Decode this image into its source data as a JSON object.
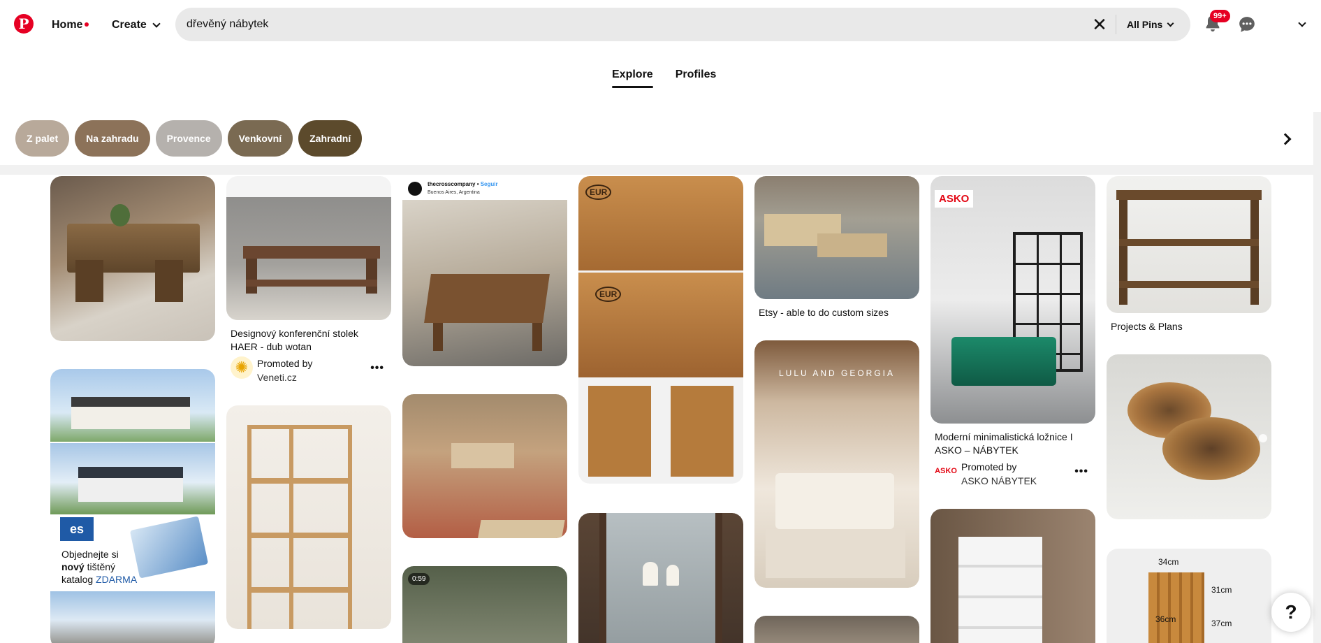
{
  "header": {
    "logo": "P",
    "home_label": "Home",
    "create_label": "Create",
    "search_value": "dřevěný nábytek",
    "clear_symbol": "✕",
    "filter_label": "All Pins",
    "notifications_badge": "99+"
  },
  "tabs": [
    {
      "label": "Explore",
      "active": true
    },
    {
      "label": "Profiles",
      "active": false
    }
  ],
  "chips": [
    {
      "label": "Z palet",
      "color": "#b8a99a"
    },
    {
      "label": "Na zahradu",
      "color": "#8c7259"
    },
    {
      "label": "Provence",
      "color": "#b5b1ad"
    },
    {
      "label": "Venkovní",
      "color": "#7a6a52"
    },
    {
      "label": "Zahradní",
      "color": "#5c4a2c"
    }
  ],
  "pins": {
    "p1": {
      "caption": ""
    },
    "p2": {
      "caption": "Designový konferenční stolek HAER - dub wotan",
      "promoted_by": "Promoted by",
      "advertiser": "Veneti.cz"
    },
    "p3": {
      "account": "thecrosscompany",
      "follow": "Seguir",
      "location": "Buenos Aires, Argentina"
    },
    "p4": {
      "overlay_a": "Objednejte si",
      "overlay_b": "nový",
      "overlay_c": "tištěný",
      "overlay_d": "katalog",
      "overlay_e": "ZDARMA",
      "brand": "es"
    },
    "p5": {
      "label_eur": "EUR"
    },
    "p6": {
      "caption": "Etsy - able to do custom sizes"
    },
    "p7": {
      "overlay": "LULU AND GEORGIA"
    },
    "p8": {
      "brand": "ASKO",
      "caption": "Moderní minimalistická ložnice I ASKO – NÁBYTEK",
      "promoted_by": "Promoted by",
      "advertiser": "ASKO NÁBYTEK"
    },
    "p9": {
      "caption": "Projects & Plans"
    },
    "p10": {
      "dim_a": "34cm",
      "dim_b": "31cm",
      "dim_c": "36cm",
      "dim_d": "37cm"
    },
    "video": {
      "duration": "0:59"
    }
  },
  "help_label": "?"
}
